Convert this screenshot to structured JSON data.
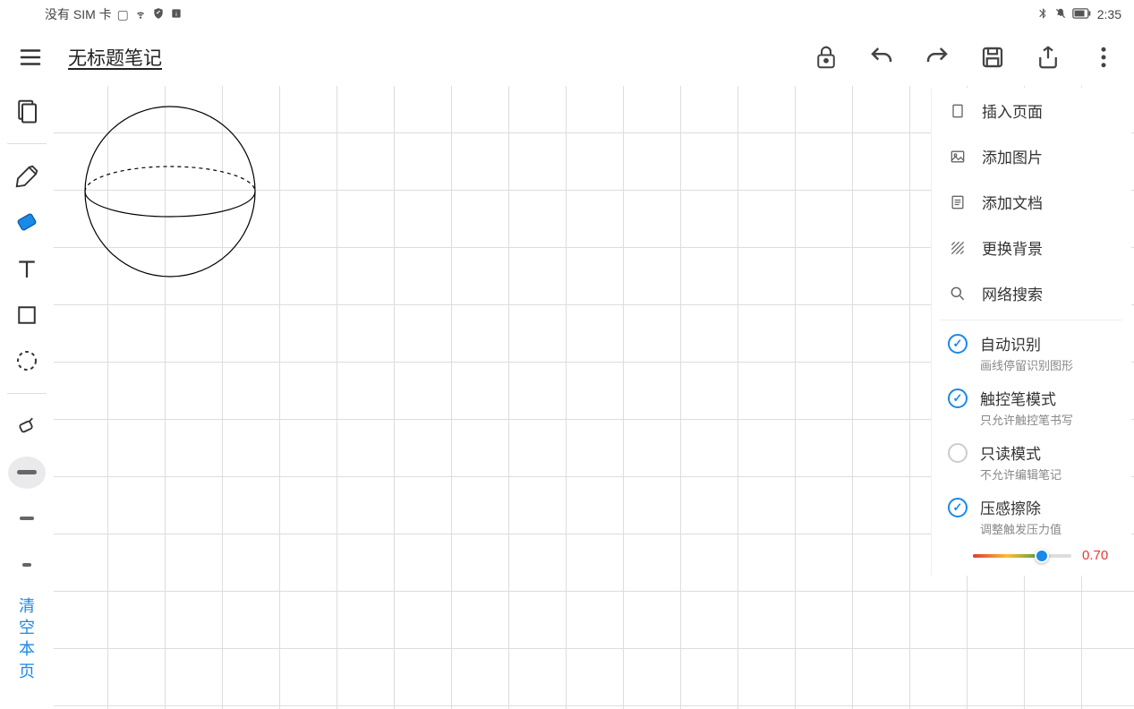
{
  "status": {
    "left_text": "没有 SIM 卡",
    "time": "2:35",
    "icons": [
      "sim-icon",
      "wifi-icon",
      "shield-icon",
      "info-icon"
    ],
    "right_icons": [
      "bluetooth-icon",
      "mute-icon",
      "battery-icon"
    ]
  },
  "header": {
    "title": "无标题笔记",
    "buttons": {
      "lock": "lock-icon",
      "undo": "undo-icon",
      "redo": "redo-icon",
      "save": "save-icon",
      "share": "share-icon",
      "more": "more-icon"
    }
  },
  "toolbar": {
    "tools": [
      {
        "name": "page-tool",
        "label": "页面"
      },
      {
        "name": "pen-tool",
        "label": "笔"
      },
      {
        "name": "eraser-tool",
        "label": "橡皮",
        "selected": true
      },
      {
        "name": "text-tool",
        "label": "文字"
      },
      {
        "name": "shape-tool",
        "label": "形状"
      },
      {
        "name": "lasso-tool",
        "label": "套索"
      },
      {
        "name": "brush-tool",
        "label": "刷子"
      }
    ],
    "weights": [
      {
        "name": "weight-large",
        "h": 6,
        "w": 22,
        "selected": true
      },
      {
        "name": "weight-medium",
        "h": 4,
        "w": 16,
        "selected": false
      },
      {
        "name": "weight-small",
        "h": 4,
        "w": 10,
        "selected": false
      }
    ],
    "clear_label": "清空本页"
  },
  "menu": {
    "actions": [
      {
        "name": "insert-page",
        "label": "插入页面",
        "icon": "page-icon"
      },
      {
        "name": "add-image",
        "label": "添加图片",
        "icon": "image-icon"
      },
      {
        "name": "add-document",
        "label": "添加文档",
        "icon": "doc-icon"
      },
      {
        "name": "change-background",
        "label": "更换背景",
        "icon": "pattern-icon"
      },
      {
        "name": "web-search",
        "label": "网络搜索",
        "icon": "search-icon"
      }
    ],
    "options": [
      {
        "name": "auto-recognize",
        "title": "自动识别",
        "subtitle": "画线停留识别图形",
        "on": true
      },
      {
        "name": "stylus-mode",
        "title": "触控笔模式",
        "subtitle": "只允许触控笔书写",
        "on": true
      },
      {
        "name": "readonly-mode",
        "title": "只读模式",
        "subtitle": "不允许编辑笔记",
        "on": false
      },
      {
        "name": "pressure-erase",
        "title": "压感擦除",
        "subtitle": "调整触发压力值",
        "on": true
      }
    ],
    "slider": {
      "value_text": "0.70",
      "value": 0.7
    }
  },
  "canvas": {
    "drawing": "sphere"
  }
}
